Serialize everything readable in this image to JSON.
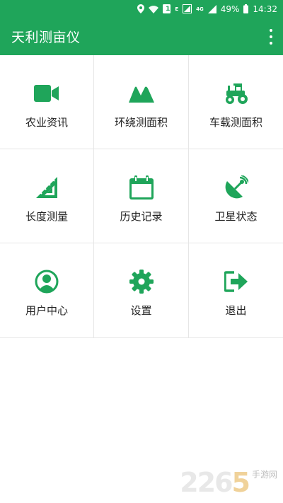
{
  "status_bar": {
    "network_tiny_1": "E",
    "network_tiny_2": "4G",
    "battery_percent": "49%",
    "time": "14:32",
    "sim_label": "1"
  },
  "app_bar": {
    "title": "天利测亩仪"
  },
  "menu": {
    "items": [
      {
        "label": "农业资讯",
        "icon": "video-camera-icon"
      },
      {
        "label": "环绕测面积",
        "icon": "mountain-icon"
      },
      {
        "label": "车载测面积",
        "icon": "tractor-icon"
      },
      {
        "label": "长度测量",
        "icon": "ruler-triangle-icon"
      },
      {
        "label": "历史记录",
        "icon": "calendar-icon"
      },
      {
        "label": "卫星状态",
        "icon": "satellite-dish-icon"
      },
      {
        "label": "用户中心",
        "icon": "user-circle-icon"
      },
      {
        "label": "设置",
        "icon": "gear-icon"
      },
      {
        "label": "退出",
        "icon": "exit-icon"
      }
    ]
  },
  "watermark": {
    "number_main": "226",
    "number_accent": "5",
    "subtitle": "手游网"
  },
  "colors": {
    "primary": "#1fa55a",
    "tile_border": "#e6e6e6",
    "label_text": "#222222"
  }
}
